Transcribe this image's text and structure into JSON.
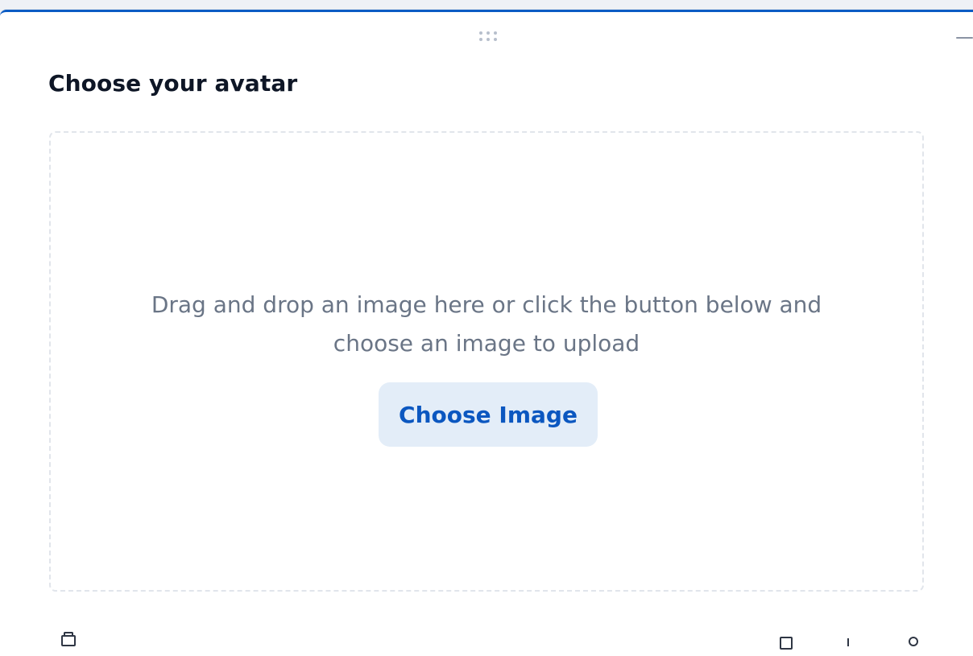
{
  "dialog": {
    "title": "Choose your avatar",
    "drag_handle_icon": "drag-handle-icon",
    "minimize_icon": "minimize-icon"
  },
  "dropzone": {
    "instructions": "Drag and drop an image here or click the button below and choose an image to upload",
    "button_label": "Choose Image"
  },
  "footer": {
    "icons": [
      "delete-icon",
      "crop-icon",
      "rotate-icon",
      "reset-icon"
    ]
  },
  "colors": {
    "accent": "#0b5cc4",
    "button_bg": "#e3edf8",
    "button_text": "#0b57c0",
    "instruction_text": "#6a7586",
    "title_text": "#0e1626"
  }
}
